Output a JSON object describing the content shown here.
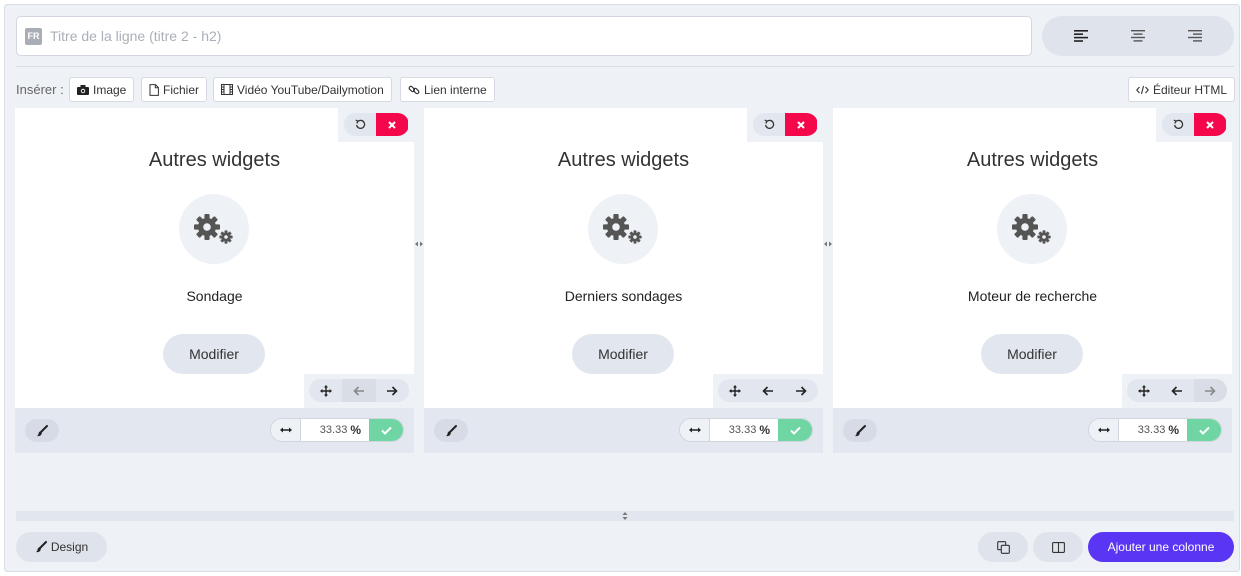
{
  "title_row": {
    "lang_badge": "FR",
    "placeholder": "Titre de la ligne (titre 2 - h2)",
    "value": ""
  },
  "alignment": {
    "options": [
      "align-left",
      "align-center",
      "align-right"
    ],
    "selected": "align-left"
  },
  "insert_toolbar": {
    "label": "Insérer :",
    "image_label": "Image",
    "file_label": "Fichier",
    "video_label": "Vidéo YouTube/Dailymotion",
    "link_label": "Lien interne",
    "html_editor_label": "Éditeur HTML"
  },
  "columns": [
    {
      "heading": "Autres widgets",
      "widget": "Sondage",
      "modify_label": "Modifier",
      "width_value": "33.33",
      "width_unit": "%"
    },
    {
      "heading": "Autres widgets",
      "widget": "Derniers sondages",
      "modify_label": "Modifier",
      "width_value": "33.33",
      "width_unit": "%"
    },
    {
      "heading": "Autres widgets",
      "widget": "Moteur de recherche",
      "modify_label": "Modifier",
      "width_value": "33.33",
      "width_unit": "%"
    }
  ],
  "footer": {
    "design_label": "Design",
    "add_column_label": "Ajouter une colonne"
  },
  "colors": {
    "delete": "#f5084b",
    "confirm": "#6fd5a3",
    "primary": "#5a36f4",
    "background": "#eef1f6"
  }
}
